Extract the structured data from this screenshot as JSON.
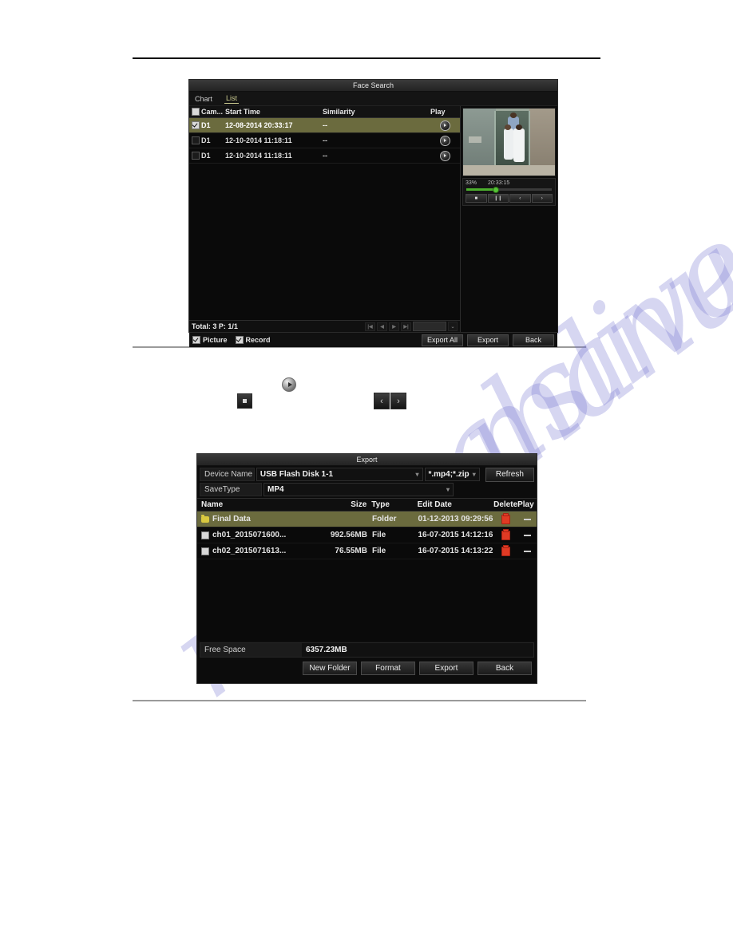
{
  "watermark": {
    "text": "manualslive.com"
  },
  "face_search": {
    "title": "Face Search",
    "tabs": [
      {
        "label": "Chart",
        "active": false
      },
      {
        "label": "List",
        "active": true
      }
    ],
    "columns": {
      "camera": "Cam...",
      "start_time": "Start Time",
      "similarity": "Similarity",
      "play": "Play"
    },
    "rows": [
      {
        "camera": "D1",
        "start_time": "12-08-2014 20:33:17",
        "similarity": "--",
        "checked": true,
        "selected": true
      },
      {
        "camera": "D1",
        "start_time": "12-10-2014 11:18:11",
        "similarity": "--",
        "checked": false,
        "selected": false
      },
      {
        "camera": "D1",
        "start_time": "12-10-2014 11:18:11",
        "similarity": "--",
        "checked": false,
        "selected": false
      }
    ],
    "total_label": "Total: 3  P: 1/1",
    "pager": {
      "first": "|◀",
      "prev": "◀",
      "next": "▶",
      "last": "▶|",
      "value": "",
      "caret": "⌄"
    },
    "preview": {
      "progress_percent": "33%",
      "timestamp": "20:33:15",
      "progress_value": 33,
      "controls": [
        {
          "name": "stop",
          "glyph": "■"
        },
        {
          "name": "pause",
          "glyph": "❙❙"
        },
        {
          "name": "prev-frame",
          "glyph": "‹"
        },
        {
          "name": "next-frame",
          "glyph": "›"
        }
      ]
    },
    "footer": {
      "picture_label": "Picture",
      "picture_checked": true,
      "record_label": "Record",
      "record_checked": true,
      "export_all": "Export All",
      "export": "Export",
      "back": "Back"
    }
  },
  "doc_icons": {
    "play": "play-icon",
    "stop": "stop-icon",
    "prev": "‹",
    "next": "›"
  },
  "export_dialog": {
    "title": "Export",
    "device_name_label": "Device Name",
    "device_name_value": "USB Flash Disk 1-1",
    "file_filter_value": "*.mp4;*.zip",
    "refresh_label": "Refresh",
    "save_type_label": "SaveType",
    "save_type_value": "MP4",
    "columns": {
      "name": "Name",
      "size": "Size",
      "type": "Type",
      "edit_date": "Edit Date",
      "delete": "Delete",
      "play": "Play"
    },
    "files": [
      {
        "name": "Final Data",
        "size": "",
        "type": "Folder",
        "edit_date": "01-12-2013 09:29:56",
        "is_folder": true,
        "checked": false,
        "selected": true
      },
      {
        "name": "ch01_2015071600...",
        "size": "992.56MB",
        "type": "File",
        "edit_date": "16-07-2015 14:12:16",
        "is_folder": false,
        "checked": false,
        "selected": false
      },
      {
        "name": "ch02_2015071613...",
        "size": "76.55MB",
        "type": "File",
        "edit_date": "16-07-2015 14:13:22",
        "is_folder": false,
        "checked": false,
        "selected": false
      }
    ],
    "free_space_label": "Free Space",
    "free_space_value": "6357.23MB",
    "buttons": {
      "new_folder": "New Folder",
      "format": "Format",
      "export": "Export",
      "back": "Back"
    }
  },
  "colors": {
    "selection": "#6b6b3e",
    "accent_tab": "#c9c98f",
    "progress": "#4caf2d",
    "delete": "#e03a24",
    "folder": "#d9c83f"
  }
}
